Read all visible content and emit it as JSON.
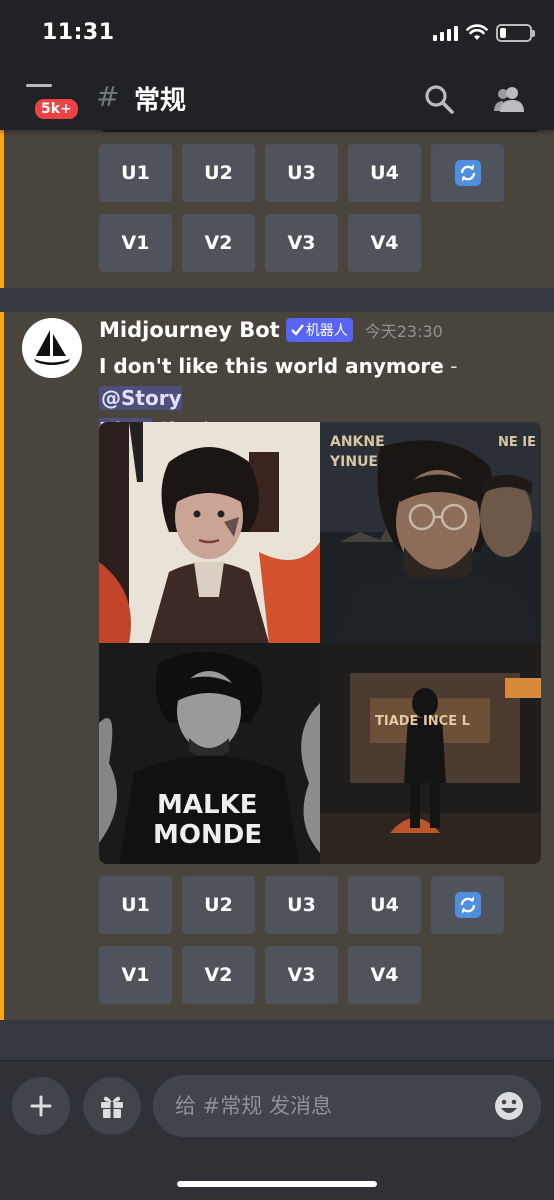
{
  "status_bar": {
    "time": "11:31",
    "battery_level": 0.2
  },
  "header": {
    "unread_badge": "5k+",
    "channel_hash": "#",
    "channel_name": "常规",
    "icons": [
      "menu-icon",
      "search-icon",
      "members-icon"
    ]
  },
  "previous_message": {
    "upscale_buttons": [
      "U1",
      "U2",
      "U3",
      "U4"
    ],
    "variation_buttons": [
      "V1",
      "V2",
      "V3",
      "V4"
    ],
    "reroll_icon": "refresh-icon"
  },
  "message": {
    "author": "Midjourney Bot",
    "bot_tag": "机器人",
    "timestamp": "今天23:30",
    "prompt": "I don't like this world anymore",
    "separator": " - ",
    "mention_part1": "@Story",
    "mention_part2": "King",
    "speed": "(fast)",
    "upscale_buttons": [
      "U1",
      "U2",
      "U3",
      "U4"
    ],
    "variation_buttons": [
      "V1",
      "V2",
      "V3",
      "V4"
    ],
    "reroll_icon": "refresh-icon",
    "images": [
      {
        "name": "image-tile-1"
      },
      {
        "name": "image-tile-2",
        "text_top": "ANKNE",
        "text_sub": "YINUE",
        "text_right": "NE IE"
      },
      {
        "name": "image-tile-3",
        "shirt_line1": "MALKE",
        "shirt_line2": "MONDE"
      },
      {
        "name": "image-tile-4",
        "sign": "TIADE INCE L"
      }
    ]
  },
  "composer": {
    "placeholder": "给 #常规 发消息",
    "icons": [
      "plus-icon",
      "gift-icon",
      "emoji-icon"
    ]
  },
  "colors": {
    "background": "#36393f",
    "header": "#202225",
    "highlight_bg": "#49443c",
    "highlight_border": "#faa61a",
    "button": "#4f545c",
    "blurple": "#5865f2",
    "badge_red": "#ed4245"
  }
}
